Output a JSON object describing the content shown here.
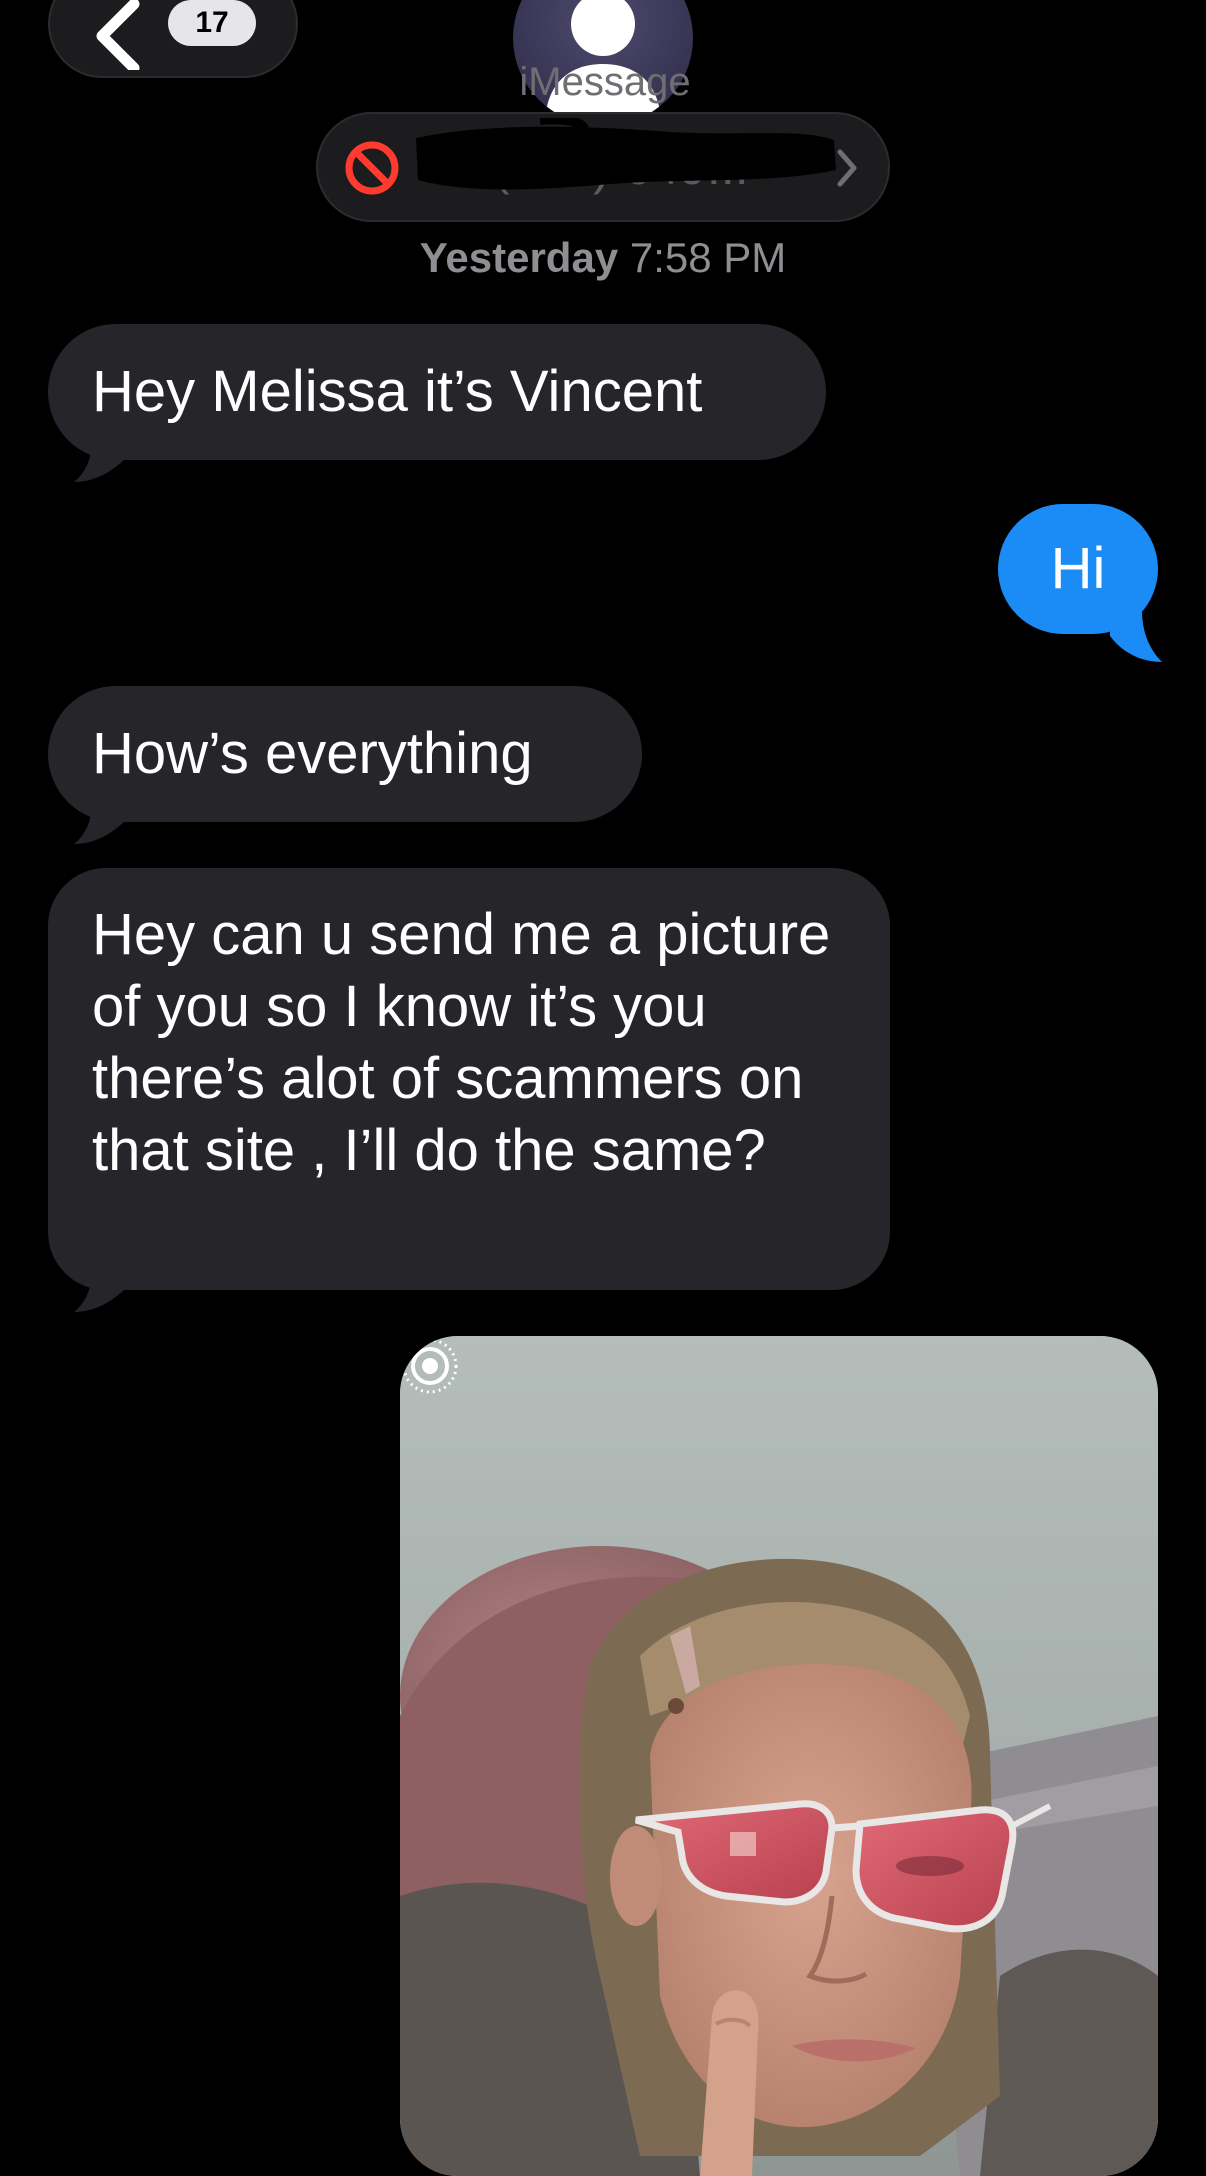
{
  "header": {
    "back_badge_count": "17",
    "contact_label": "iMessage",
    "contact_number": "+1 (914) 649...",
    "back_icon": "chevron-left-icon",
    "blocked_icon": "prohibited-icon"
  },
  "conversation": {
    "timestamp_day": "Yesterday",
    "timestamp_time": "7:58 PM",
    "messages": [
      {
        "direction": "incoming",
        "text": "Hey Melissa it’s Vincent"
      },
      {
        "direction": "outgoing",
        "text": "Hi"
      },
      {
        "direction": "incoming",
        "text": "How’s everything"
      },
      {
        "direction": "incoming",
        "text": "Hey can u send me a picture of you so I know it’s you there’s alot of scammers on that site , I’ll do the same?"
      },
      {
        "direction": "outgoing",
        "type": "photo",
        "badge_icon": "live-photo-icon"
      }
    ]
  },
  "colors": {
    "background": "#000000",
    "incoming_bubble": "#26252a",
    "outgoing_bubble": "#1b8bf5",
    "timestamp": "#8e8e93",
    "blocked_red": "#ff3b30"
  }
}
